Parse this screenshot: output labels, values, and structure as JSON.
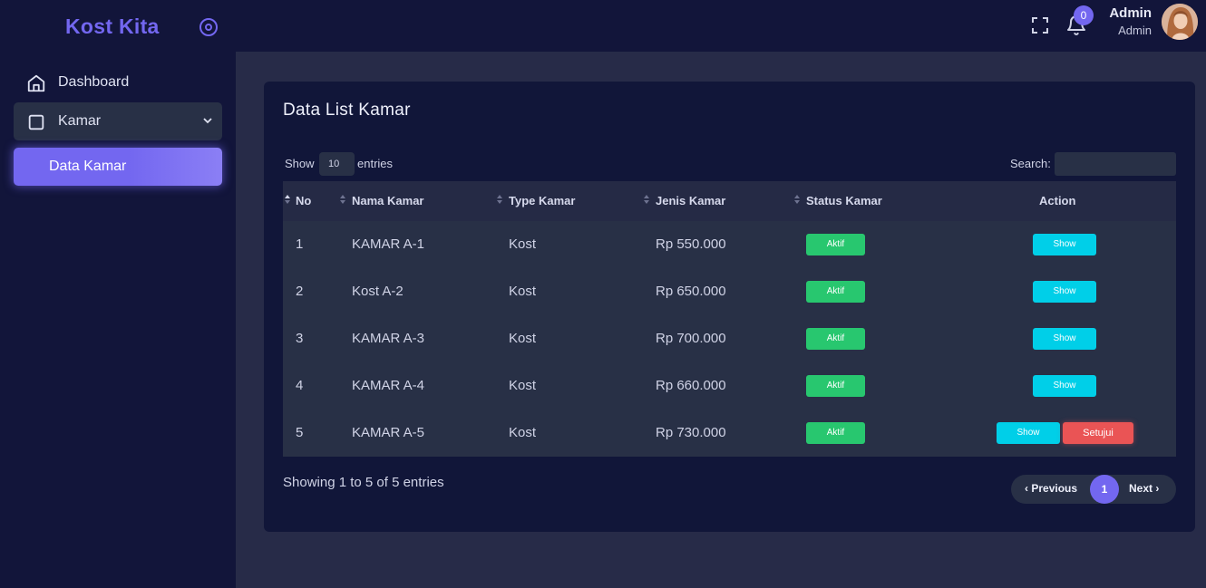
{
  "brand": {
    "name": "Kost Kita"
  },
  "header": {
    "notification_count": "0",
    "user_name": "Admin",
    "user_role": "Admin"
  },
  "sidebar": {
    "items": [
      {
        "label": "Dashboard",
        "icon": "home-icon"
      },
      {
        "label": "Kamar",
        "icon": "square-icon"
      },
      {
        "label": "Data Kamar"
      }
    ]
  },
  "page": {
    "title": "Data List Kamar",
    "show_label": "Show",
    "page_length": "10",
    "entries_label": "entries",
    "search_label": "Search:",
    "search_value": ""
  },
  "table": {
    "columns": [
      "No",
      "Nama Kamar",
      "Type Kamar",
      "Jenis Kamar",
      "Status Kamar",
      "Action"
    ],
    "rows": [
      {
        "no": "1",
        "nama": "KAMAR A-1",
        "type": "Kost",
        "jenis": "Rp 550.000",
        "status": "Aktif",
        "actions": [
          "Show"
        ]
      },
      {
        "no": "2",
        "nama": "Kost A-2",
        "type": "Kost",
        "jenis": "Rp 650.000",
        "status": "Aktif",
        "actions": [
          "Show"
        ]
      },
      {
        "no": "3",
        "nama": "KAMAR A-3",
        "type": "Kost",
        "jenis": "Rp 700.000",
        "status": "Aktif",
        "actions": [
          "Show"
        ]
      },
      {
        "no": "4",
        "nama": "KAMAR A-4",
        "type": "Kost",
        "jenis": "Rp 660.000",
        "status": "Aktif",
        "actions": [
          "Show"
        ]
      },
      {
        "no": "5",
        "nama": "KAMAR A-5",
        "type": "Kost",
        "jenis": "Rp 730.000",
        "status": "Aktif",
        "actions": [
          "Show",
          "Setujui"
        ]
      }
    ]
  },
  "footer": {
    "info": "Showing 1 to 5 of 5 entries",
    "previous": "Previous",
    "current_page": "1",
    "next": "Next"
  },
  "colors": {
    "accent": "#7367f0",
    "success": "#28c76f",
    "info": "#00cfe8",
    "danger": "#ea5455",
    "panel": "#111639",
    "background": "#272b48"
  }
}
